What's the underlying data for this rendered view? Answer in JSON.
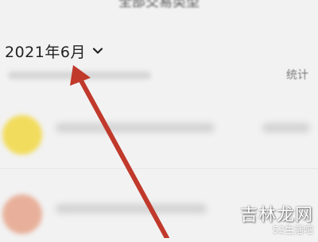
{
  "header": {
    "title": "全部交易类型"
  },
  "month_selector": {
    "label": "2021年6月",
    "icon": "chevron-down-icon"
  },
  "summary": {
    "stats_link": "统计"
  },
  "list": {
    "items": [
      {
        "avatar_color": "#f2dc5d"
      },
      {
        "avatar_color": "#e8b09a"
      }
    ]
  },
  "annotation": {
    "arrow_color": "#c0392b"
  },
  "watermark": {
    "main": "吉林龙网",
    "sub": "52生活吧"
  }
}
